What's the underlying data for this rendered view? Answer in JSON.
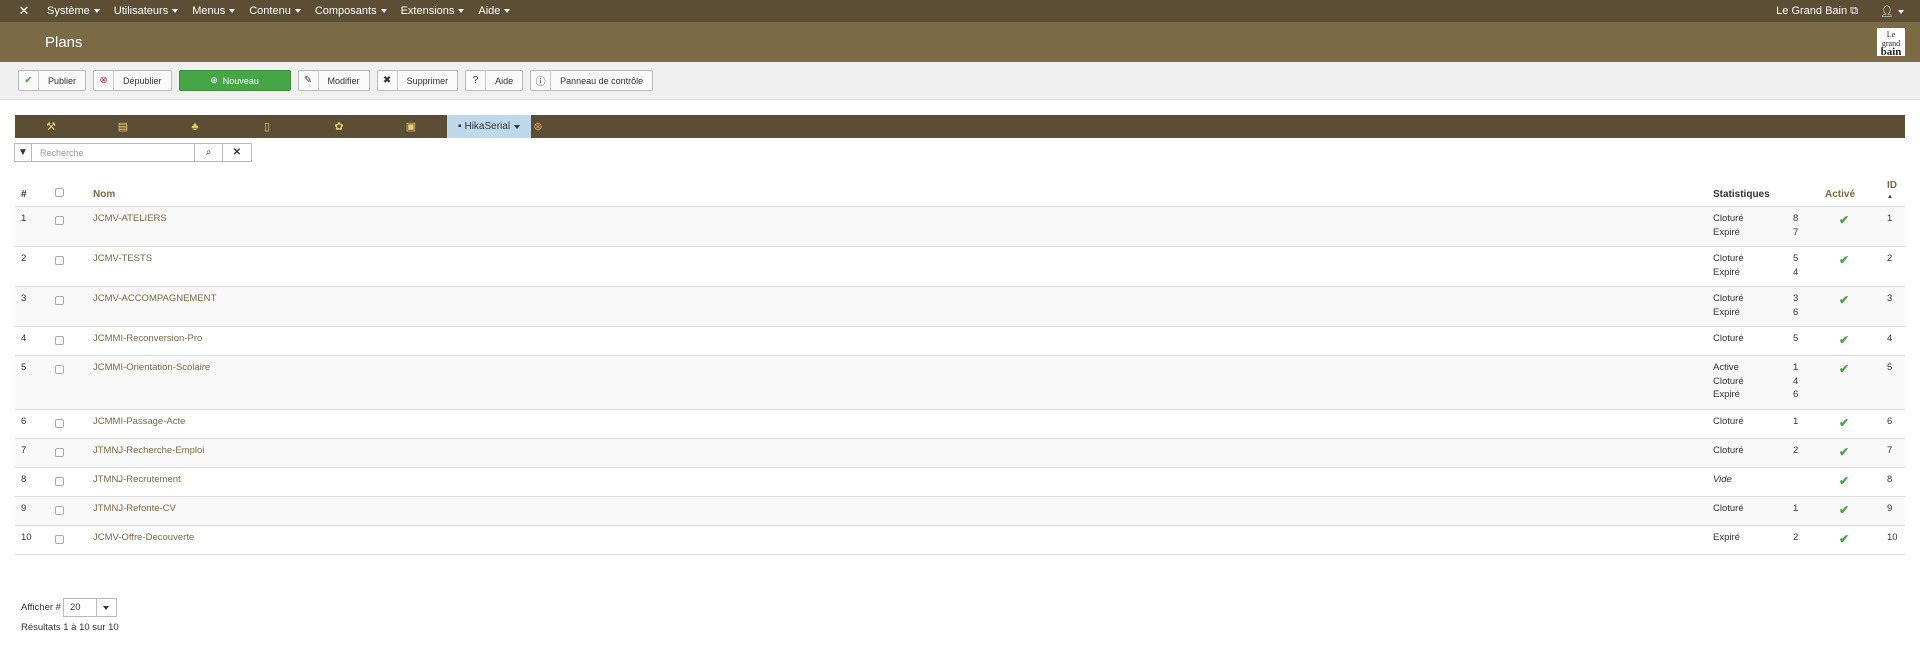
{
  "navbar": {
    "menus": [
      "Système",
      "Utilisateurs",
      "Menus",
      "Contenu",
      "Composants",
      "Extensions",
      "Aide"
    ],
    "site": "Le Grand Bain ⧉",
    "user_icon": "user-icon"
  },
  "header": {
    "title": "Plans",
    "brand_line1": "Le grand",
    "brand_line2": "bain"
  },
  "toolbar": {
    "publish": "Publier",
    "unpublish": "Dépublier",
    "new": "Nouveau",
    "edit": "Modifier",
    "delete": "Supprimer",
    "help": "Aide",
    "cpanel": "Panneau de contrôle"
  },
  "tabs": {
    "active_label": "HikaSerial"
  },
  "search": {
    "placeholder": "Recherche"
  },
  "table": {
    "headers": {
      "num": "#",
      "name": "Nom",
      "stats": "Statistiques",
      "active": "Activé",
      "id": "ID",
      "id_sort": "▲"
    },
    "rows": [
      {
        "num": "1",
        "name": "JCMV-ATELIERS",
        "stats": [
          [
            "Cloturé",
            "8"
          ],
          [
            "Expiré",
            "7"
          ]
        ],
        "id": "1"
      },
      {
        "num": "2",
        "name": "JCMV-TESTS",
        "stats": [
          [
            "Cloturé",
            "5"
          ],
          [
            "Expiré",
            "4"
          ]
        ],
        "id": "2"
      },
      {
        "num": "3",
        "name": "JCMV-ACCOMPAGNEMENT",
        "stats": [
          [
            "Cloturé",
            "3"
          ],
          [
            "Expiré",
            "6"
          ]
        ],
        "id": "3"
      },
      {
        "num": "4",
        "name": "JCMMI-Reconversion-Pro",
        "stats": [
          [
            "Cloturé",
            "5"
          ]
        ],
        "id": "4"
      },
      {
        "num": "5",
        "name": "JCMMI-Orientation-Scolaire",
        "stats": [
          [
            "Active",
            "1"
          ],
          [
            "Cloturé",
            "4"
          ],
          [
            "Expiré",
            "6"
          ]
        ],
        "id": "5"
      },
      {
        "num": "6",
        "name": "JCMMI-Passage-Acte",
        "stats": [
          [
            "Cloturé",
            "1"
          ]
        ],
        "id": "6"
      },
      {
        "num": "7",
        "name": "JTMNJ-Recherche-Emploi",
        "stats": [
          [
            "Cloturé",
            "2"
          ]
        ],
        "id": "7"
      },
      {
        "num": "8",
        "name": "JTMNJ-Recrutement",
        "stats": [
          [
            "Vide",
            ""
          ]
        ],
        "id": "8"
      },
      {
        "num": "9",
        "name": "JTMNJ-Refonte-CV",
        "stats": [
          [
            "Cloturé",
            "1"
          ]
        ],
        "id": "9"
      },
      {
        "num": "10",
        "name": "JCMV-Offre-Decouverte",
        "stats": [
          [
            "Expiré",
            "2"
          ]
        ],
        "id": "10"
      }
    ]
  },
  "footer": {
    "limit_label": "Afficher #",
    "limit_value": "20",
    "results": "Résultats 1 à 10 sur 10"
  },
  "colors": {
    "navbar": "#5b4e35",
    "header": "#7b6a46",
    "accent_green": "#46a546"
  }
}
